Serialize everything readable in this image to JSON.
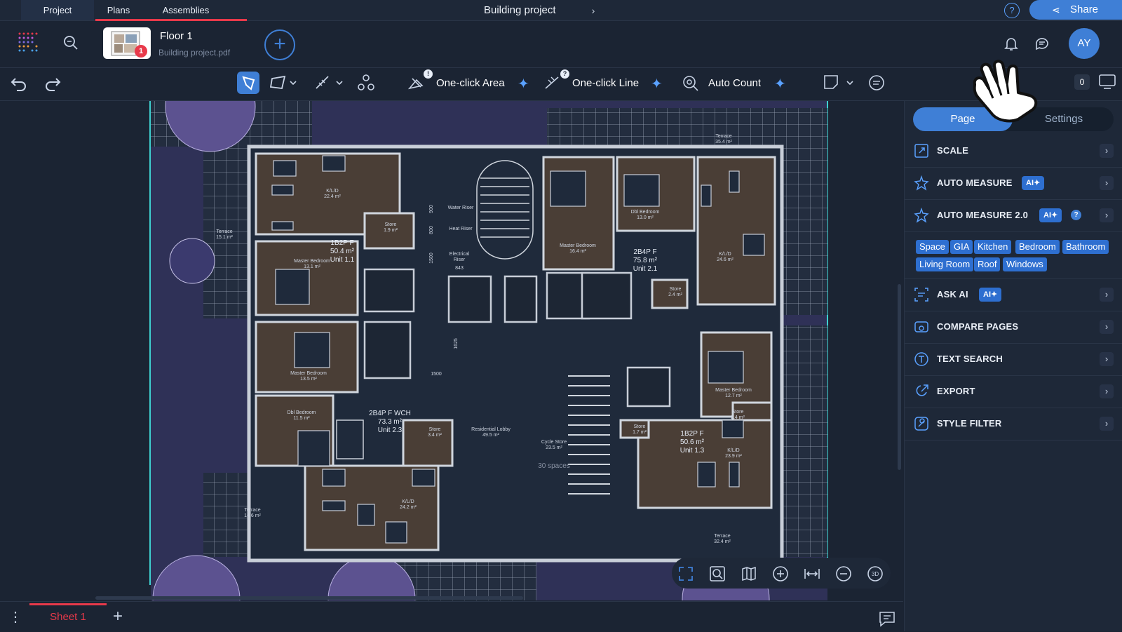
{
  "top_tabs": [
    {
      "label": "Project"
    },
    {
      "label": "Plans"
    },
    {
      "label": "Assemblies"
    }
  ],
  "header": {
    "project_title": "Building project",
    "help": "?",
    "share_label": "Share"
  },
  "plan": {
    "name": "Floor 1",
    "file": "Building project.pdf",
    "badge_count": "1"
  },
  "user": {
    "initials": "AY"
  },
  "toolbar": {
    "one_click_area": "One-click Area",
    "one_click_line": "One-click Line",
    "auto_count": "Auto Count",
    "area_badge": "!",
    "line_badge": "?",
    "count_value": "0"
  },
  "panel": {
    "tabs": {
      "page": "Page",
      "settings": "Settings"
    },
    "rows": [
      {
        "label": "SCALE"
      },
      {
        "label": "AUTO MEASURE",
        "badge": "AI✦"
      },
      {
        "label": "AUTO MEASURE 2.0",
        "badge": "AI✦",
        "help": "?"
      },
      {
        "label": "ASK AI",
        "badge": "AI✦"
      },
      {
        "label": "COMPARE PAGES"
      },
      {
        "label": "TEXT SEARCH"
      },
      {
        "label": "EXPORT"
      },
      {
        "label": "STYLE FILTER"
      }
    ],
    "chips": [
      "Space",
      "GIA",
      "Kitchen",
      "Bedroom",
      "Bathroom",
      "Living Room",
      "Roof",
      "Windows"
    ]
  },
  "floorplan": {
    "units": [
      {
        "name": "1B2P F",
        "area": "50.4 m²",
        "unit": "Unit 1.1"
      },
      {
        "name": "2B4P F",
        "area": "75.8 m²",
        "unit": "Unit 2.1"
      },
      {
        "name": "2B4P F WCH",
        "area": "73.3 m²",
        "unit": "Unit 2.3"
      },
      {
        "name": "1B2P F",
        "area": "50.6 m²",
        "unit": "Unit 1.3"
      }
    ],
    "rooms": [
      {
        "name": "K/L/D",
        "area": "22.4 m²"
      },
      {
        "name": "Master Bedroom",
        "area": "13.1 m²"
      },
      {
        "name": "Master Bedroom",
        "area": "13.5 m²"
      },
      {
        "name": "Dbl Bedroom",
        "area": "11.5 m²"
      },
      {
        "name": "K/L/D",
        "area": "24.2 m²"
      },
      {
        "name": "Store",
        "area": "3.4 m²"
      },
      {
        "name": "Residential Lobby",
        "area": "49.5 m²"
      },
      {
        "name": "Cycle Store",
        "area": "23.5 m²"
      },
      {
        "name": "Dbl Bedroom",
        "area": "13.0 m²"
      },
      {
        "name": "Master Bedroom",
        "area": "16.4 m²"
      },
      {
        "name": "K/L/D",
        "area": "24.6 m²"
      },
      {
        "name": "Store",
        "area": "2.4 m²"
      },
      {
        "name": "Master Bedroom",
        "area": "12.7 m²"
      },
      {
        "name": "K/L/D",
        "area": "23.9 m²"
      },
      {
        "name": "Store",
        "area": "1.7 m²"
      },
      {
        "name": "Terrace",
        "area": "15.1 m²"
      },
      {
        "name": "Terrace",
        "area": "14.6 m²"
      },
      {
        "name": "Terrace",
        "area": "32.4 m²"
      },
      {
        "name": "Terrace",
        "area": "35.4 m²"
      },
      {
        "name": "Store",
        "area": "1.9 m²"
      },
      {
        "name": "Store",
        "area": "2.4 m²"
      }
    ],
    "core": [
      "Water Riser",
      "Heat Riser",
      "Electrical Riser"
    ],
    "dims": [
      "900",
      "800",
      "1500",
      "843",
      "1625",
      "1500"
    ],
    "cycle_spaces": "30 spaces"
  },
  "sheet": {
    "label": "Sheet 1"
  },
  "colors": {
    "accent": "#3f7fd6",
    "brand_red": "#e8394a",
    "room_fill": "#4a3e36",
    "plan_bg": "#1f2a3b",
    "site": "#2f3157"
  }
}
